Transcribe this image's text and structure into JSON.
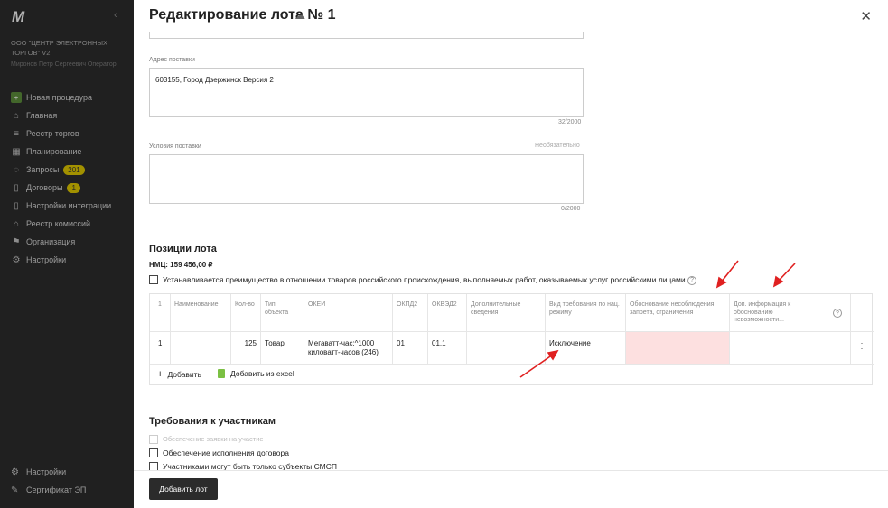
{
  "sidebar": {
    "logo": "M",
    "collapse_icon": "‹",
    "org_name": "ООО \"ЦЕНТР ЭЛЕКТРОННЫХ ТОРГОВ\" v2",
    "user_name": "Миронов Петр Сергеевич Оператор",
    "items": [
      {
        "label": "Новая процедура",
        "icon": "plus-icon"
      },
      {
        "label": "Главная",
        "icon": "home-icon"
      },
      {
        "label": "Реестр торгов",
        "icon": "list-icon"
      },
      {
        "label": "Планирование",
        "icon": "calendar-icon"
      },
      {
        "label": "Запросы",
        "icon": "chat-icon",
        "badge": "201"
      },
      {
        "label": "Договоры",
        "icon": "document-icon",
        "badge": "1"
      },
      {
        "label": "Настройки интеграции",
        "icon": "document-icon"
      },
      {
        "label": "Реестр комиссий",
        "icon": "home-icon"
      },
      {
        "label": "Организация",
        "icon": "flag-icon"
      },
      {
        "label": "Настройки",
        "icon": "gear-icon"
      }
    ],
    "bottom_items": [
      {
        "label": "Настройки",
        "icon": "gear-icon"
      },
      {
        "label": "Сертификат ЭП",
        "icon": "pen-icon"
      }
    ]
  },
  "header": {
    "title": "Редактирование лота № 1",
    "cloud_icon": "☁",
    "close_icon": "✕"
  },
  "form": {
    "address_label": "Адрес поставки",
    "address_value": "603155, Город Дзержинск Версия 2",
    "address_counter": "32/2000",
    "conditions_label": "Условия поставки",
    "conditions_optional": "Необязательно",
    "conditions_value": "",
    "conditions_counter": "0/2000"
  },
  "positions": {
    "title": "Позиции лота",
    "nmc": "НМЦ: 159 456,00 ₽",
    "preference_checkbox": "Устанавливается преимущество в отношении товаров российского происхождения, выполняемых работ, оказываемых услуг российскими лицами",
    "columns": [
      "1",
      "Наименование",
      "Кол-во",
      "Тип объекта",
      "ОКЕИ",
      "ОКПД2",
      "ОКВЭД2",
      "Дополнительные сведения",
      "Вид требования по нац. режиму",
      "Обоснование несоблюдения запрета, ограничения",
      "Доп. информация к обоснованию невозможности..."
    ],
    "rows": [
      {
        "num": "1",
        "name": "",
        "qty": "125",
        "type": "Товар",
        "okei": "Мегаватт-час;^1000 киловатт-часов (246)",
        "okpd2": "01",
        "okved2": "01.1",
        "extra": "",
        "requirement": "Исключение",
        "reason": "",
        "info": ""
      }
    ],
    "add_label": "Добавить",
    "add_excel_label": "Добавить из excel"
  },
  "requirements": {
    "title": "Требования к участникам",
    "items": [
      {
        "label": "Обеспечение заявки на участие",
        "disabled": true
      },
      {
        "label": "Обеспечение исполнения договора",
        "disabled": false
      },
      {
        "label": "Участниками могут быть только субъекты СМСП",
        "disabled": false
      }
    ]
  },
  "footer": {
    "add_lot_label": "Добавить лот"
  },
  "colors": {
    "sidebar_bg": "#2b2b2b",
    "highlight_cell": "#fde0e0",
    "annotation_arrow": "#e02020",
    "badge": "#d9c200"
  }
}
